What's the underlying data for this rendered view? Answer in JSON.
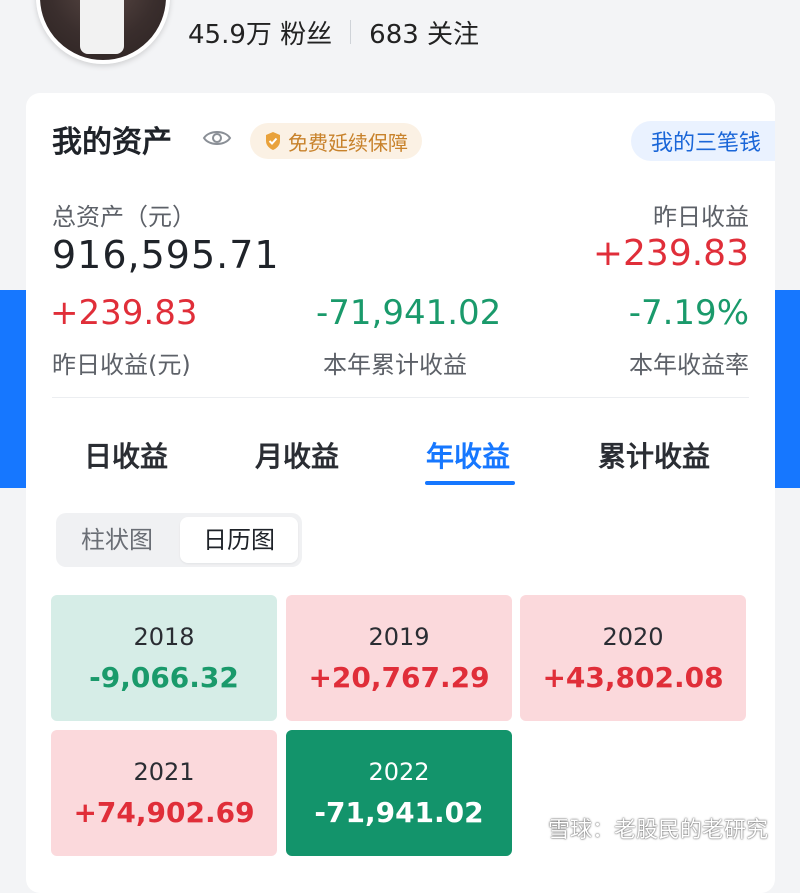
{
  "profile": {
    "followers": "45.9万 粉丝",
    "following": "683 关注"
  },
  "assets": {
    "title": "我的资产",
    "badge": "免费延续保障",
    "three_money": "我的三笔钱",
    "total_label": "总资产（元）",
    "total_value": "916,595.71",
    "yesterday_label": "昨日收益",
    "yesterday_value": "+239.83",
    "metrics": [
      {
        "value": "+239.83",
        "label": "昨日收益(元)"
      },
      {
        "value": "-71,941.02",
        "label": "本年累计收益"
      },
      {
        "value": "-7.19%",
        "label": "本年收益率"
      }
    ]
  },
  "tabs": [
    "日收益",
    "月收益",
    "年收益",
    "累计收益"
  ],
  "active_tab": "年收益",
  "view_toggle": {
    "options": [
      "柱状图",
      "日历图"
    ],
    "selected": "日历图"
  },
  "years": [
    {
      "year": "2018",
      "value": "-9,066.32"
    },
    {
      "year": "2019",
      "value": "+20,767.29"
    },
    {
      "year": "2020",
      "value": "+43,802.08"
    },
    {
      "year": "2021",
      "value": "+74,902.69"
    },
    {
      "year": "2022",
      "value": "-71,941.02"
    }
  ],
  "watermark": "雪球：老股民的老研究",
  "colors": {
    "accent": "#1677ff",
    "gain": "#e02e39",
    "loss": "#1a9a6b"
  }
}
